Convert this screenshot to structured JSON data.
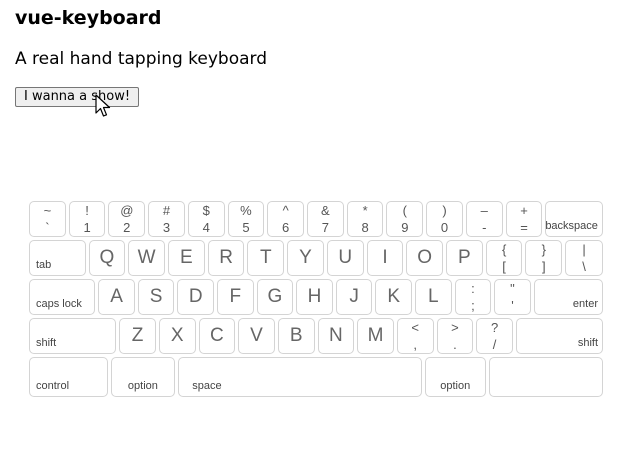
{
  "title": "vue-keyboard",
  "subtitle": "A real hand tapping keyboard",
  "button_label": "I wanna a show!",
  "cursor_icon": "arrow-cursor-icon",
  "keyboard": {
    "row1": [
      {
        "top": "~",
        "bottom": "`"
      },
      {
        "top": "!",
        "bottom": "1"
      },
      {
        "top": "@",
        "bottom": "2"
      },
      {
        "top": "#",
        "bottom": "3"
      },
      {
        "top": "$",
        "bottom": "4"
      },
      {
        "top": "%",
        "bottom": "5"
      },
      {
        "top": "^",
        "bottom": "6"
      },
      {
        "top": "&",
        "bottom": "7"
      },
      {
        "top": "*",
        "bottom": "8"
      },
      {
        "top": "(",
        "bottom": "9"
      },
      {
        "top": ")",
        "bottom": "0"
      },
      {
        "top": "–",
        "bottom": "-"
      },
      {
        "top": "+",
        "bottom": "="
      }
    ],
    "backspace": "backspace",
    "tab": "tab",
    "row2": [
      "Q",
      "W",
      "E",
      "R",
      "T",
      "Y",
      "U",
      "I",
      "O",
      "P"
    ],
    "row2_symbols": [
      {
        "top": "{",
        "bottom": "["
      },
      {
        "top": "}",
        "bottom": "]"
      },
      {
        "top": "|",
        "bottom": "\\"
      }
    ],
    "caps_lock": "caps lock",
    "row3": [
      "A",
      "S",
      "D",
      "F",
      "G",
      "H",
      "J",
      "K",
      "L"
    ],
    "row3_symbols": [
      {
        "top": ":",
        "bottom": ";"
      },
      {
        "top": "\"",
        "bottom": "'"
      }
    ],
    "enter": "enter",
    "shift_left": "shift",
    "row4": [
      "Z",
      "X",
      "C",
      "V",
      "B",
      "N",
      "M"
    ],
    "row4_symbols": [
      {
        "top": "<",
        "bottom": ","
      },
      {
        "top": ">",
        "bottom": "."
      },
      {
        "top": "?",
        "bottom": "/"
      }
    ],
    "shift_right": "shift",
    "control": "control",
    "option_left": "option",
    "space": "space",
    "option_right": "option",
    "last_key": ""
  }
}
